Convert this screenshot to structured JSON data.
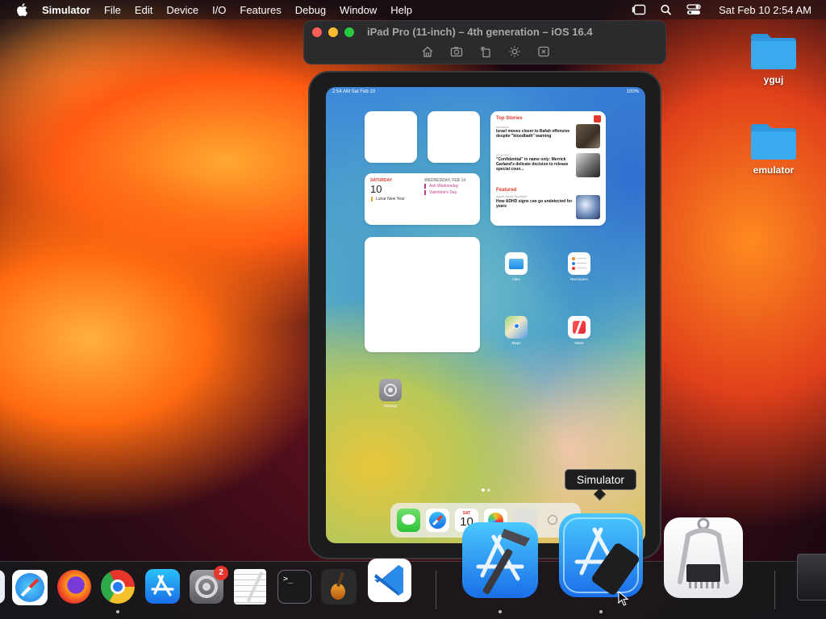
{
  "menubar": {
    "app_name": "Simulator",
    "items": [
      "File",
      "Edit",
      "Device",
      "I/O",
      "Features",
      "Debug",
      "Window",
      "Help"
    ],
    "clock": "Sat Feb 10  2:54 AM"
  },
  "simulator": {
    "title": "iPad Pro (11-inch) – 4th generation – iOS 16.4",
    "tools": [
      "home-icon",
      "screenshot-icon",
      "rotate-icon",
      "appearance-icon",
      "close-icon"
    ]
  },
  "ios": {
    "status_time": "2:54 AM   Sat Feb 10",
    "status_battery": "100%",
    "calendar_widget": {
      "day_label": "SATURDAY",
      "date": "10",
      "event": "Lunar New Year",
      "next_day_label": "WEDNESDAY, FEB 14",
      "next_events": [
        "Ash Wednesday",
        "Valentine's Day"
      ]
    },
    "news_widget": {
      "header": "Top Stories",
      "stories": [
        {
          "source": "nbcnews",
          "headline": "Israel moves closer to Rafah offensive despite \"bloodbath\" warning"
        },
        {
          "source": "POLITICO",
          "headline": "\"Confidential\" in name only: Merrick Garland's delicate decision to release special coun..."
        }
      ],
      "featured_label": "Featured",
      "featured_source": "Apple News Spotlight",
      "featured_headline": "How ADHD signs can go undetected for years"
    },
    "apps": [
      {
        "name": "Files"
      },
      {
        "name": "Reminders"
      },
      {
        "name": "Maps"
      },
      {
        "name": "News"
      },
      {
        "name": "Settings"
      }
    ],
    "dock_calendar": {
      "day": "SAT",
      "date": "10"
    }
  },
  "desktop_folders": [
    {
      "name": "yguj"
    },
    {
      "name": "emulator"
    }
  ],
  "tooltip": "Simulator",
  "dock": {
    "apps": [
      "Finder",
      "Safari",
      "Firefox",
      "Google Chrome",
      "App Store",
      "System Settings",
      "TextEdit",
      "Terminal",
      "GarageBand",
      "Visual Studio Code",
      "Xcode",
      "Simulator",
      "System Information"
    ],
    "settings_badge": "2"
  },
  "colors": {
    "close": "#ff5f57",
    "minimize": "#febc2e",
    "zoom": "#28c840",
    "folder": "#3aa9ee"
  }
}
